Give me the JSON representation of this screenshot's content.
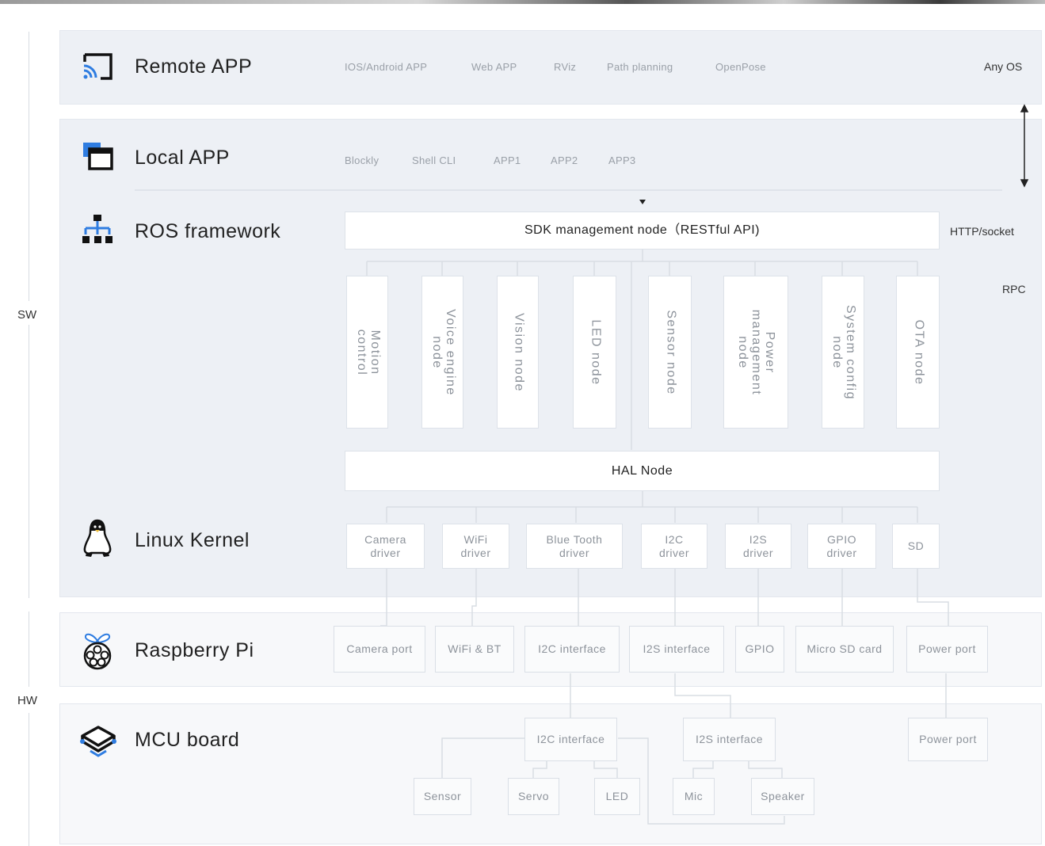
{
  "sides": {
    "sw": "SW",
    "hw": "HW"
  },
  "layers": {
    "remote": {
      "title": "Remote APP",
      "tags": [
        "IOS/Android APP",
        "Web APP",
        "RViz",
        "Path planning",
        "OpenPose"
      ],
      "right": "Any OS"
    },
    "local": {
      "title": "Local APP",
      "tags": [
        "Blockly",
        "Shell CLI",
        "APP1",
        "APP2",
        "APP3"
      ]
    },
    "ros": {
      "title": "ROS framework",
      "sdk": "SDK management node（RESTful API)",
      "http": "HTTP/socket",
      "rpc": "RPC",
      "nodes": [
        "Motion\ncontrol",
        "Voice engine\nnode",
        "Vision node",
        "LED node",
        "Sensor node",
        "Power\nmanagement\nnode",
        "System config\nnode",
        "OTA node"
      ],
      "hal": "HAL Node"
    },
    "kernel": {
      "title": "Linux Kernel",
      "drivers": [
        "Camera\ndriver",
        "WiFi\ndriver",
        "Blue Tooth\ndriver",
        "I2C\ndriver",
        "I2S\ndriver",
        "GPIO\ndriver",
        "SD"
      ]
    },
    "rpi": {
      "title": "Raspberry Pi",
      "ports": [
        "Camera port",
        "WiFi & BT",
        "I2C interface",
        "I2S interface",
        "GPIO",
        "Micro SD card",
        "Power port"
      ]
    },
    "mcu": {
      "title": "MCU board",
      "interfaces": [
        "I2C interface",
        "I2S interface",
        "Power port"
      ],
      "devices": [
        "Sensor",
        "Servo",
        "LED",
        "Mic",
        "Speaker"
      ]
    }
  }
}
